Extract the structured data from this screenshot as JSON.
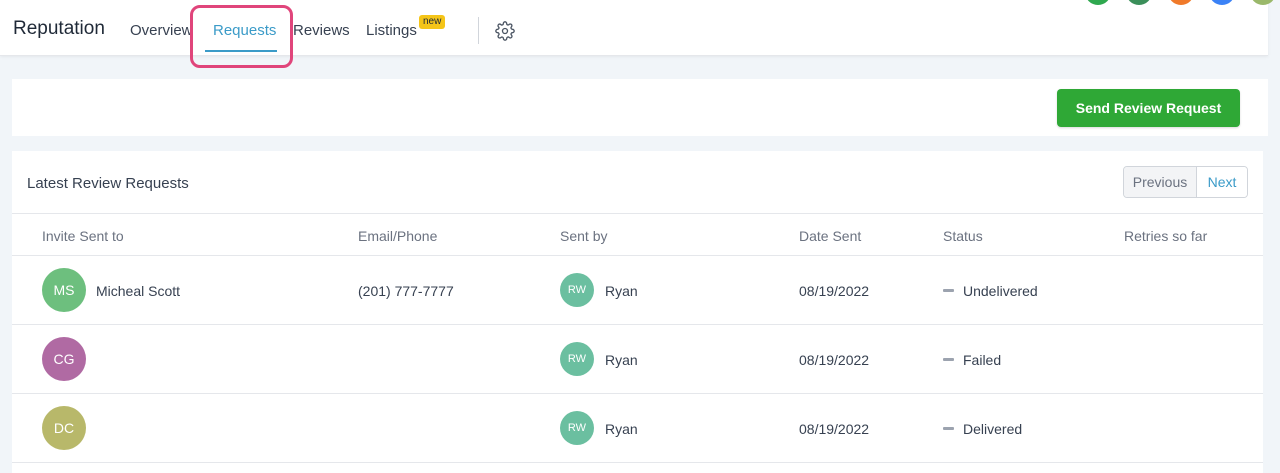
{
  "header": {
    "brand": "Reputation",
    "tabs": [
      {
        "label": "Overview"
      },
      {
        "label": "Requests",
        "active": true
      },
      {
        "label": "Reviews"
      },
      {
        "label": "Listings",
        "badge": "new"
      }
    ],
    "settings_icon": "gear-icon",
    "accent_color": "#3b9bc8",
    "highlight_color": "#e0457b"
  },
  "actions": {
    "send_label": "Send Review Request",
    "send_color": "#2fa836"
  },
  "table": {
    "title": "Latest Review Requests",
    "pager": {
      "prev": "Previous",
      "next": "Next"
    },
    "columns": [
      "Invite Sent to",
      "Email/Phone",
      "Sent by",
      "Date Sent",
      "Status",
      "Retries so far"
    ],
    "rows": [
      {
        "initials": "MS",
        "name": "Micheal Scott",
        "email_phone": "(201) 777-7777",
        "sent_by_initials": "RW",
        "sent_by": "Ryan",
        "date": "08/19/2022",
        "status": "Undelivered",
        "avatar_color": "#6dbf7e"
      },
      {
        "initials": "CG",
        "name": "",
        "email_phone": "",
        "sent_by_initials": "RW",
        "sent_by": "Ryan",
        "date": "08/19/2022",
        "status": "Failed",
        "avatar_color": "#b06aa3"
      },
      {
        "initials": "DC",
        "name": "",
        "email_phone": "",
        "sent_by_initials": "RW",
        "sent_by": "Ryan",
        "date": "08/19/2022",
        "status": "Delivered",
        "avatar_color": "#b8b86a"
      }
    ]
  },
  "top_avatar_colors": [
    "#2fa84f",
    "#3b8f5a",
    "#f07a2a",
    "#3b82f6",
    "#9ab86a"
  ]
}
